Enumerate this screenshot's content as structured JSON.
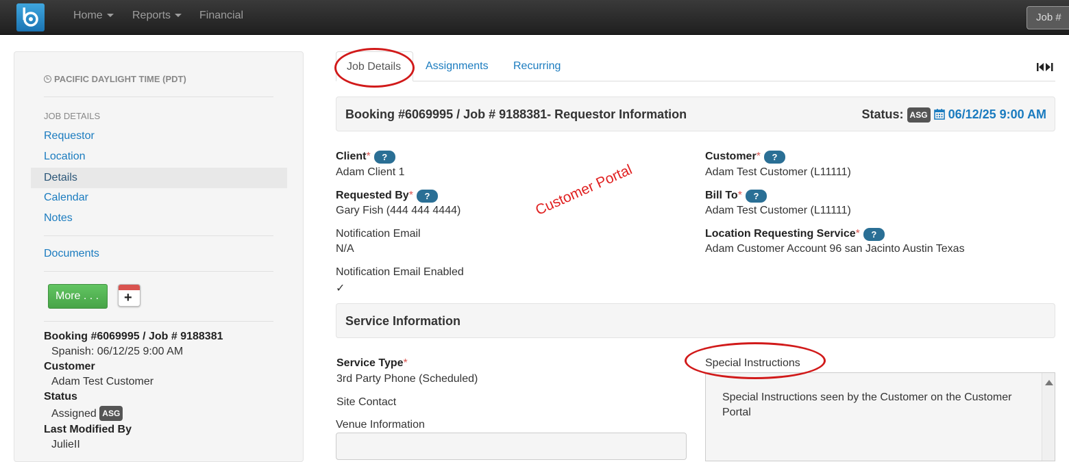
{
  "nav": {
    "items": [
      {
        "label": "Home",
        "has_caret": true
      },
      {
        "label": "Reports",
        "has_caret": true
      },
      {
        "label": "Financial",
        "has_caret": false
      }
    ],
    "job_search_label": "Job #"
  },
  "sidebar": {
    "timezone": "PACIFIC DAYLIGHT TIME (PDT)",
    "section_heading": "JOB DETAILS",
    "links": [
      "Requestor",
      "Location",
      "Details",
      "Calendar",
      "Notes"
    ],
    "active_link": "Details",
    "documents_link": "Documents",
    "more_button": "More . . .",
    "summary": {
      "booking": "Booking #6069995 / Job # 9188381",
      "booking_detail": "Spanish: 06/12/25 9:00 AM",
      "customer_label": "Customer",
      "customer_value": "Adam Test Customer",
      "status_label": "Status",
      "status_value": "Assigned",
      "status_badge": "ASG",
      "modified_label": "Last Modified By",
      "modified_value": "JulieII"
    }
  },
  "tabs": [
    {
      "label": "Job Details",
      "active": true
    },
    {
      "label": "Assignments",
      "active": false
    },
    {
      "label": "Recurring",
      "active": false
    }
  ],
  "requestor_panel": {
    "title": "Booking #6069995 / Job # 9188381- Requestor Information",
    "status_label": "Status:",
    "status_badge": "ASG",
    "status_datetime": "06/12/25 9:00 AM"
  },
  "requestor_fields": {
    "client_label": "Client",
    "client_value": "Adam Client 1",
    "requested_by_label": "Requested By",
    "requested_by_value": "Gary Fish (444 444 4444)",
    "notification_email_label": "Notification Email",
    "notification_email_value": "N/A",
    "notification_enabled_label": "Notification Email Enabled",
    "notification_enabled_value": "✓",
    "customer_label": "Customer",
    "customer_value": "Adam Test Customer (L11111)",
    "bill_to_label": "Bill To",
    "bill_to_value": "Adam Test Customer (L11111)",
    "location_label": "Location Requesting Service",
    "location_value": "Adam Customer Account 96 san Jacinto Austin Texas",
    "required_mark": "*",
    "help_label": "?"
  },
  "annotation": {
    "text": "Customer Portal",
    "color": "#e02020"
  },
  "service_panel": {
    "title": "Service Information"
  },
  "service_fields": {
    "service_type_label": "Service Type",
    "service_type_value": "3rd Party Phone (Scheduled)",
    "site_contact_label": "Site Contact",
    "venue_label": "Venue Information",
    "special_instructions_label": "Special Instructions",
    "special_instructions_text": "Special Instructions seen by the Customer on the Customer Portal"
  },
  "colors": {
    "link": "#1a7bbf",
    "required": "#d9534f",
    "help_badge": "#2a6f95",
    "more_button": "#5cb85c",
    "annotation_ellipse": "#d11a1a"
  }
}
